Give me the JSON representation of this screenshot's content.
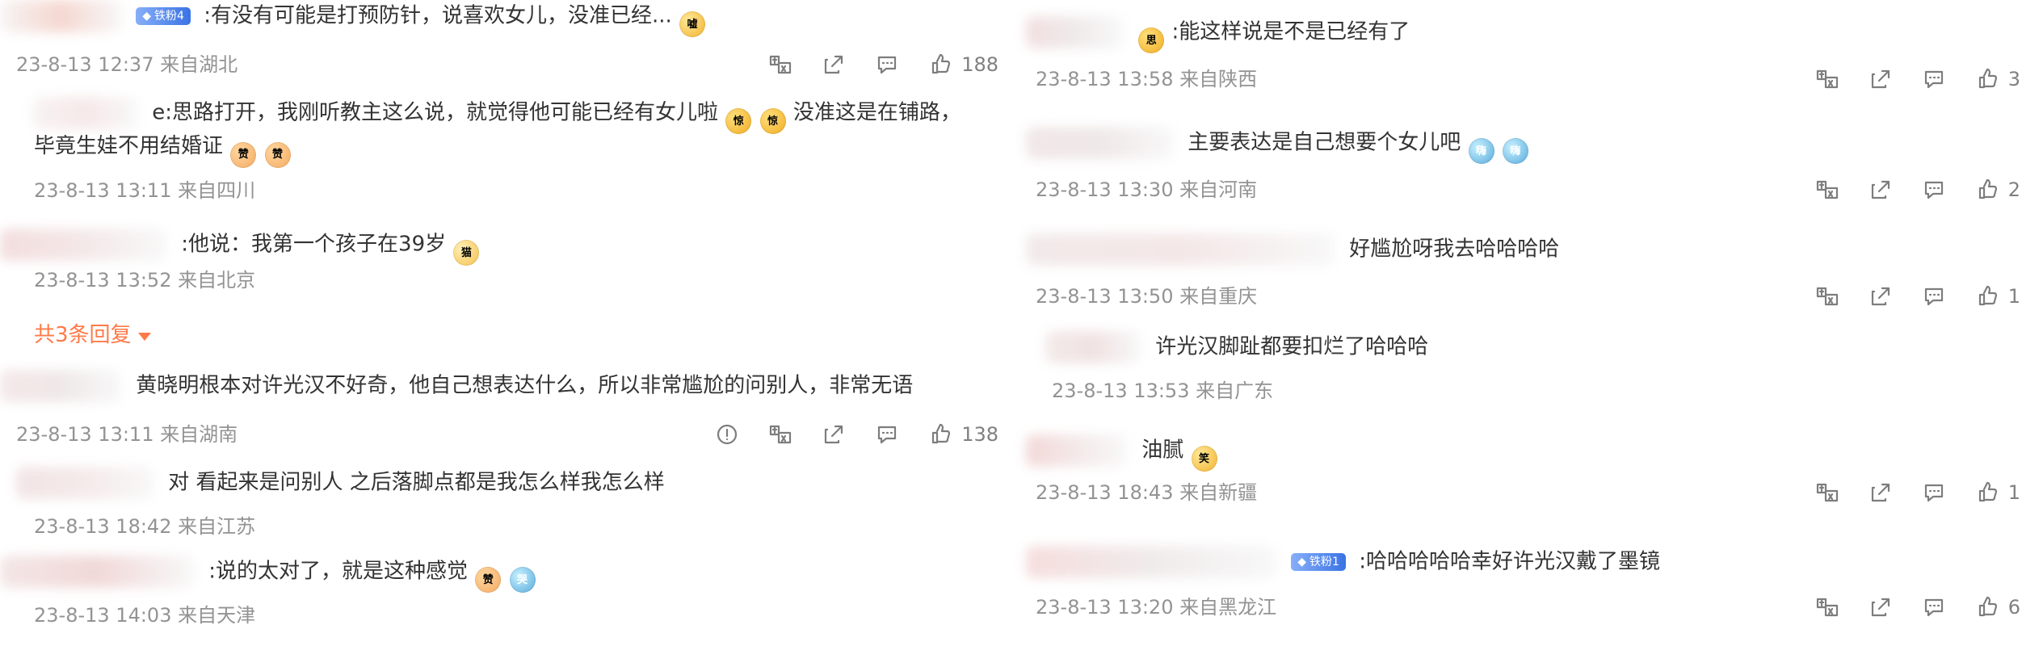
{
  "left": {
    "comment1": {
      "badge": "铁粉4",
      "text": ":有没有可能是打预防针，说喜欢女儿，没准已经...",
      "emoji": "嘘",
      "meta": "23-8-13 12:37 来自湖北",
      "like_count": "188"
    },
    "comment2": {
      "line1_pre": "e:思路打开，我刚听教主这么说，就觉得他可能已经有女儿啦",
      "line1_emoji1": "惊",
      "line1_emoji2": "惊",
      "line1_post": "没准这是在铺路，",
      "line2_text": "毕竟生娃不用结婚证",
      "line2_emoji1": "赞",
      "line2_emoji2": "赞",
      "meta": "23-8-13 13:11 来自四川"
    },
    "comment3": {
      "text": ":他说：我第一个孩子在39岁",
      "emoji": "猫",
      "meta": "23-8-13 13:52 来自北京"
    },
    "reply_toggle": "共3条回复",
    "comment4": {
      "text": "黄晓明根本对许光汉不好奇，他自己想表达什么，所以非常尴尬的问别人，非常无语",
      "meta": "23-8-13 13:11 来自湖南",
      "like_count": "138"
    },
    "comment5": {
      "text": "对 看起来是问别人 之后落脚点都是我怎么样我怎么样",
      "meta": "23-8-13 18:42 来自江苏"
    },
    "comment6": {
      "text": ":说的太对了，就是这种感觉",
      "emoji1": "赞",
      "emoji2": "哭",
      "meta": "23-8-13 14:03 来自天津"
    }
  },
  "right": {
    "comment1": {
      "text": ":能这样说是不是已经有了",
      "emoji": "思",
      "meta": "23-8-13 13:58 来自陕西",
      "like_count": "3"
    },
    "comment2": {
      "text": "主要表达是自己想要个女儿吧",
      "emoji1": "嗨",
      "emoji2": "嗨",
      "meta": "23-8-13 13:30 来自河南",
      "like_count": "2"
    },
    "comment3": {
      "text": "好尴尬呀我去哈哈哈哈",
      "meta": "23-8-13 13:50 来自重庆",
      "like_count": "1"
    },
    "comment4": {
      "text": "许光汉脚趾都要扣烂了哈哈哈",
      "meta": "23-8-13 13:53 来自广东"
    },
    "comment5": {
      "text": "油腻",
      "emoji": "笑",
      "meta": "23-8-13 18:43 来自新疆",
      "like_count": "1"
    },
    "comment6": {
      "badge": "铁粉1",
      "text": ":哈哈哈哈哈幸好许光汉戴了墨镜",
      "meta": "23-8-13 13:20 来自黑龙江",
      "like_count": "6"
    }
  },
  "icons": {
    "translate": "translate-icon",
    "share": "share-icon",
    "reply": "comment-icon",
    "like": "like-icon",
    "report": "report-icon"
  },
  "colors": {
    "text": "#333333",
    "meta": "#939393",
    "icon": "#808080",
    "accent": "#ff7a48",
    "badge": "#3a73e6"
  }
}
